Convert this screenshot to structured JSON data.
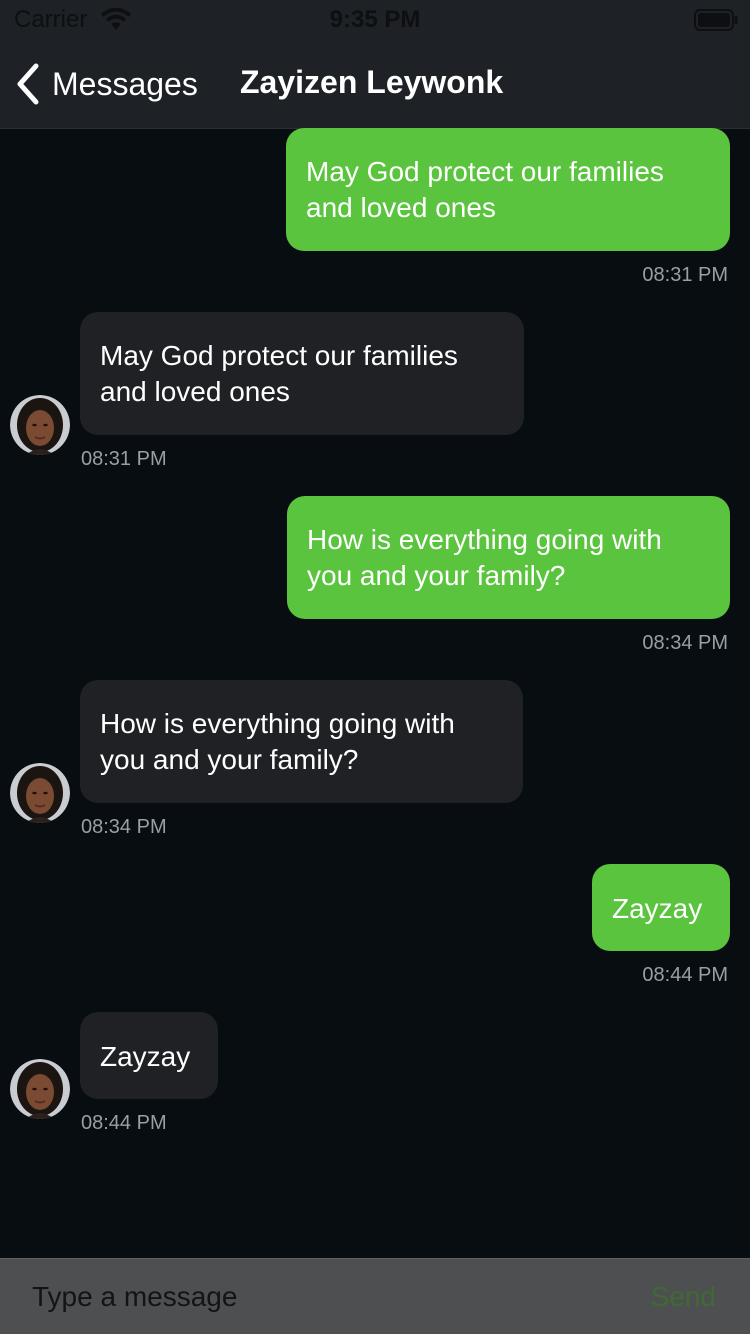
{
  "status_bar": {
    "carrier": "Carrier",
    "time": "9:35 PM",
    "wifi_icon": "wifi-icon",
    "battery_icon": "battery-icon"
  },
  "nav": {
    "back_label": "Messages",
    "back_icon": "chevron-left-icon",
    "title": "Zayizen Leywonk"
  },
  "messages": [
    {
      "direction": "outgoing",
      "text": "May God protect our families and loved ones",
      "time": "08:31 PM"
    },
    {
      "direction": "incoming",
      "text": "May God protect our families and loved ones",
      "time": "08:31 PM"
    },
    {
      "direction": "outgoing",
      "text": "How is everything going with you and your family?",
      "time": "08:34 PM"
    },
    {
      "direction": "incoming",
      "text": "How is everything going with you and your family?",
      "time": "08:34 PM"
    },
    {
      "direction": "outgoing",
      "text": "Zayzay",
      "time": "08:44 PM"
    },
    {
      "direction": "incoming",
      "text": "Zayzay",
      "time": "08:44 PM"
    }
  ],
  "composer": {
    "placeholder": "Type a message",
    "send_label": "Send"
  },
  "colors": {
    "background": "#080d12",
    "bar": "#1e2125",
    "outgoing_bubble": "#5ac43e",
    "incoming_bubble": "#1f2125",
    "timestamp": "#9a9ea5"
  }
}
